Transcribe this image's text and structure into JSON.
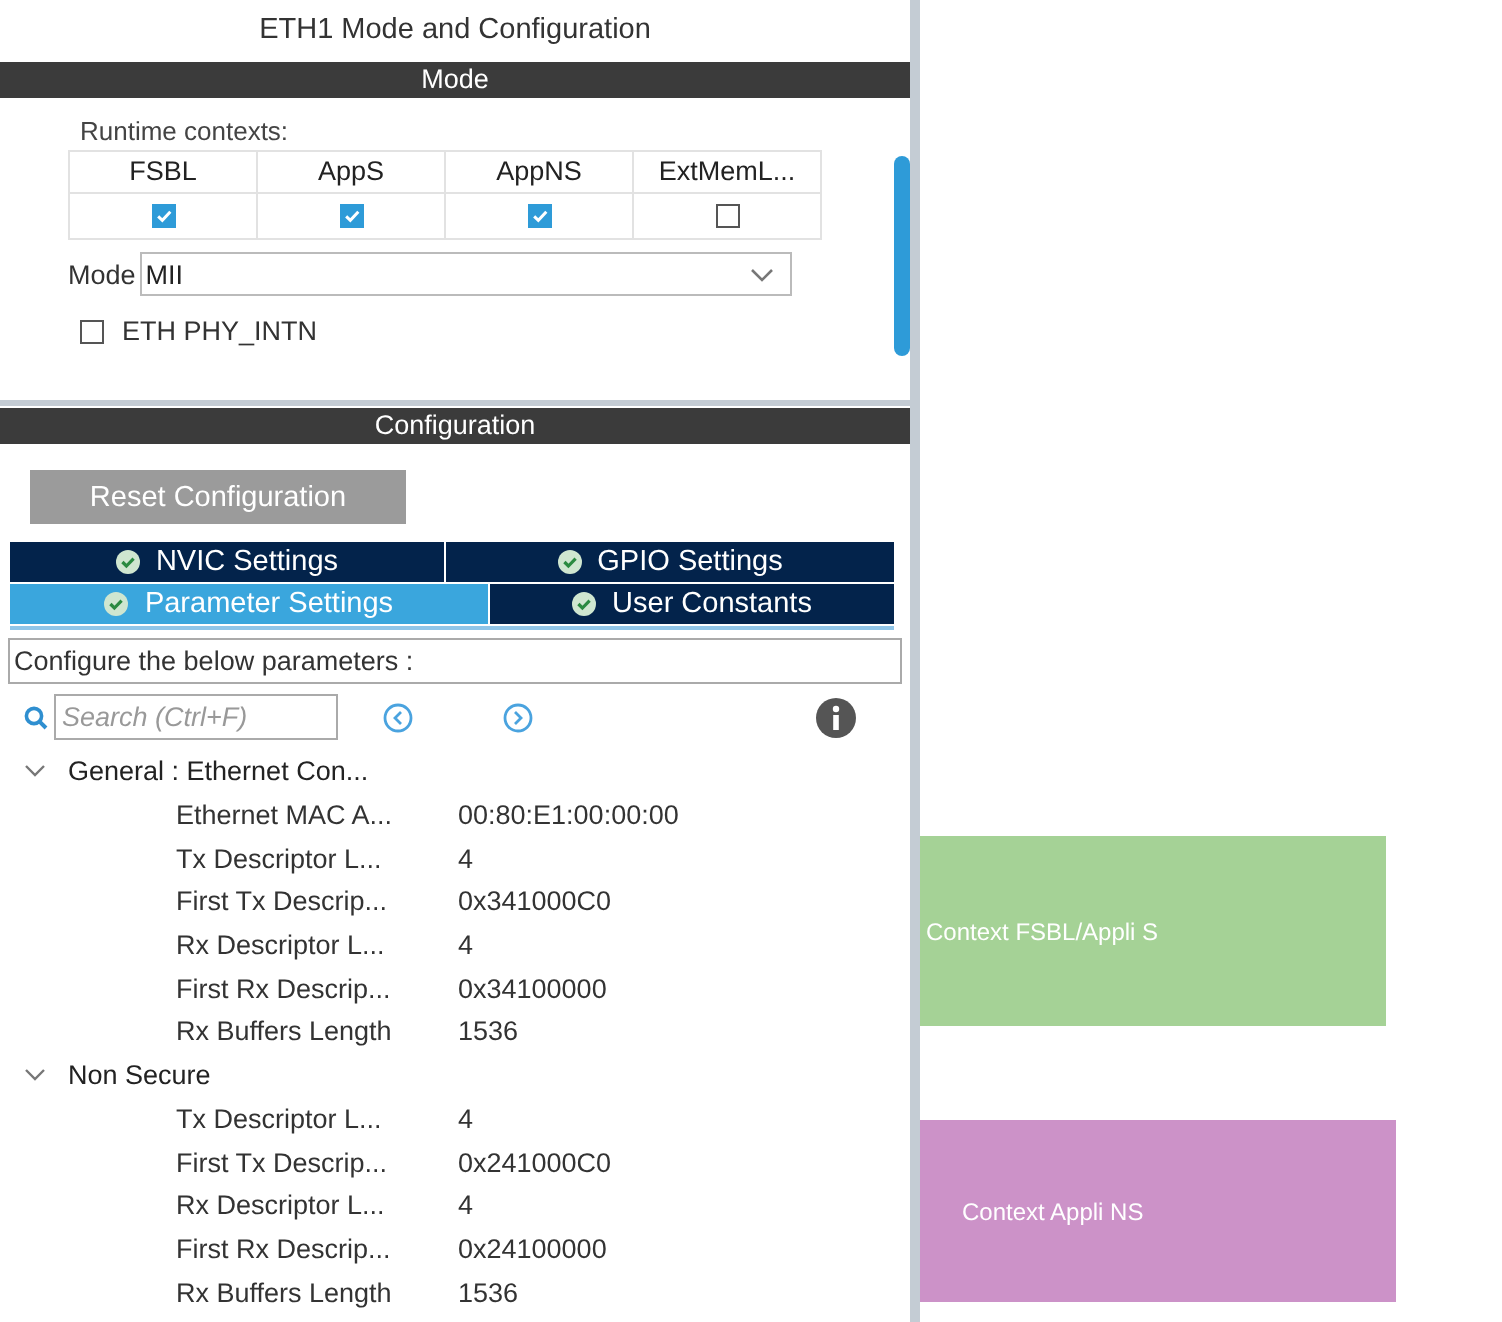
{
  "window": {
    "title": "ETH1 Mode and Configuration"
  },
  "mode_section": {
    "header": "Mode",
    "runtime_label": "Runtime contexts:",
    "contexts": [
      {
        "name": "FSBL",
        "checked": true
      },
      {
        "name": "AppS",
        "checked": true
      },
      {
        "name": "AppNS",
        "checked": true
      },
      {
        "name": "ExtMemL...",
        "checked": false
      }
    ],
    "mode_label": "Mode",
    "mode_value": "MII",
    "options": [
      {
        "label": "ETH PHY_INTN",
        "checked": false
      }
    ]
  },
  "config_section": {
    "header": "Configuration",
    "reset_button": "Reset Configuration",
    "tabs": [
      {
        "label": "NVIC Settings",
        "selected": false
      },
      {
        "label": "GPIO Settings",
        "selected": false
      },
      {
        "label": "Parameter Settings",
        "selected": true
      },
      {
        "label": "User Constants",
        "selected": false
      }
    ],
    "description": "Configure the below parameters :",
    "search": {
      "placeholder": "Search (Ctrl+F)"
    },
    "tree": [
      {
        "label": "General : Ethernet Con...",
        "expanded": true,
        "children": [
          {
            "label": "Ethernet MAC A...",
            "value": "00:80:E1:00:00:00"
          },
          {
            "label": "Tx Descriptor L...",
            "value": "4"
          },
          {
            "label": "First Tx Descrip...",
            "value": "0x341000C0"
          },
          {
            "label": "Rx Descriptor L...",
            "value": "4"
          },
          {
            "label": "First Rx Descrip...",
            "value": "0x34100000"
          },
          {
            "label": "Rx Buffers Length",
            "value": "1536"
          }
        ]
      },
      {
        "label": "Non Secure",
        "expanded": true,
        "children": [
          {
            "label": "Tx Descriptor L...",
            "value": "4"
          },
          {
            "label": "First Tx Descrip...",
            "value": "0x241000C0"
          },
          {
            "label": "Rx Descriptor L...",
            "value": "4"
          },
          {
            "label": "First Rx Descrip...",
            "value": "0x24100000"
          },
          {
            "label": "Rx Buffers Length",
            "value": "1536"
          }
        ]
      }
    ]
  },
  "callouts": [
    {
      "text": "Context FSBL/Appli S",
      "color": "#a5d296"
    },
    {
      "text": "Context Appli NS",
      "color": "#cc92c8"
    }
  ]
}
